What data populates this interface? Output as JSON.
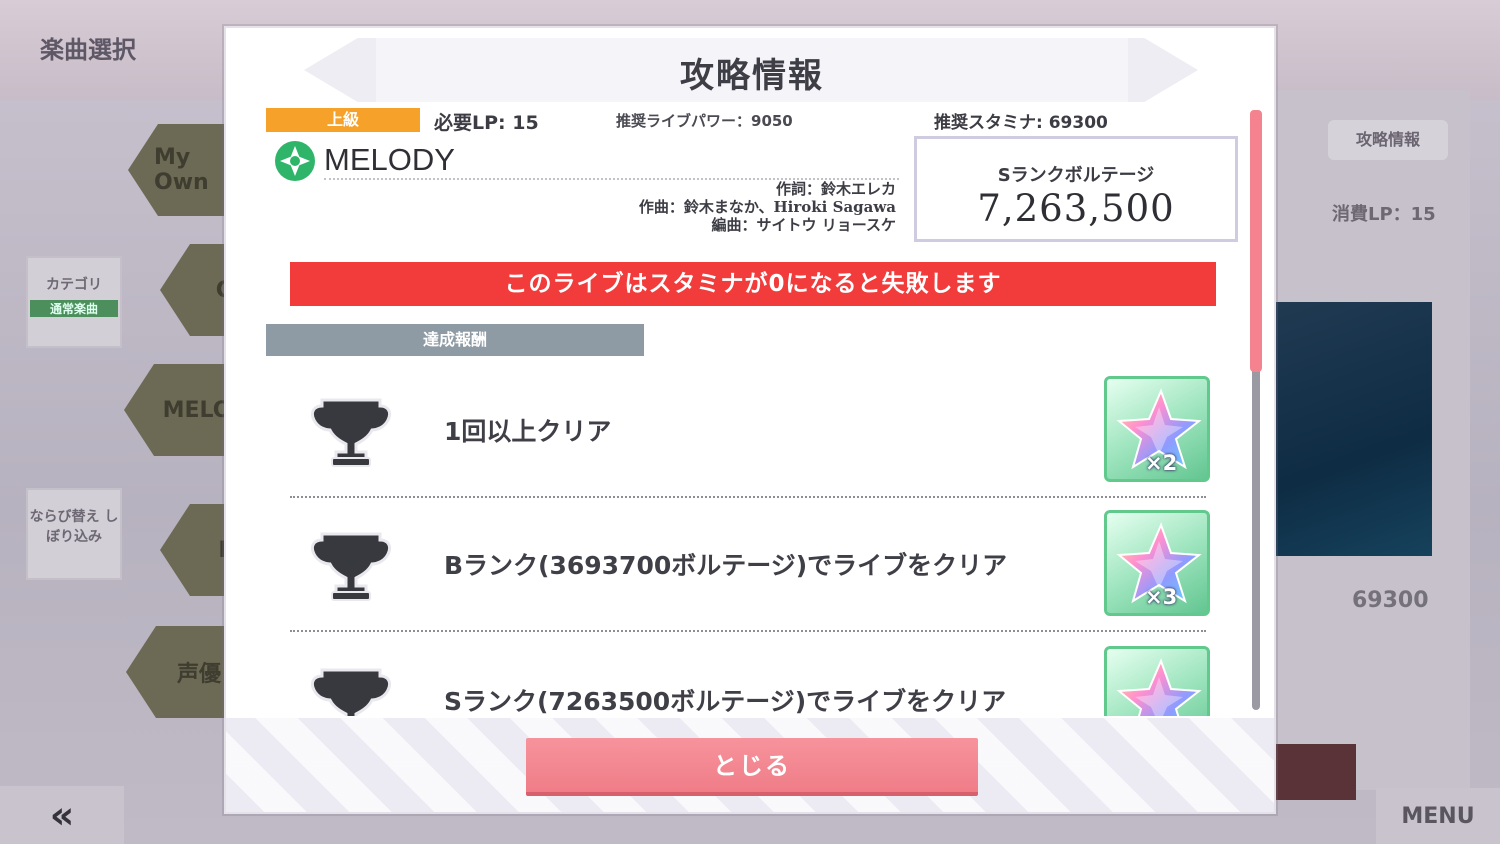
{
  "background": {
    "screen_title": "楽曲選択",
    "hex_labels": [
      "My Own",
      "CH",
      "MELO",
      "Ev",
      "声優"
    ],
    "category_label": "カテゴリ",
    "category_value": "通常楽曲",
    "sort_label": "ならび替え しぼり込み",
    "back_symbol": "«",
    "menu_label": "MENU",
    "side_info_button": "攻略情報",
    "side_lp": "消費LP：15",
    "side_stamina": "69300"
  },
  "dialog": {
    "title": "攻略情報",
    "difficulty": "上級",
    "required_lp": "必要LP: 15",
    "recommended_power": "推奨ライブパワー：9050",
    "recommended_stamina": "推奨スタミナ: 69300",
    "song_title": "MELODY",
    "credits": {
      "lyrics": "作詞：鈴木エレカ",
      "composer": "作曲：鈴木まなか、Hiroki Sagawa",
      "arranger": "編曲：サイトウ リョースケ"
    },
    "s_rank": {
      "label": "Sランクボルテージ",
      "value": "7,263,500"
    },
    "warning": "このライブはスタミナが0になると失敗します",
    "reward_header": "達成報酬",
    "missions": [
      {
        "label": "1回以上クリア",
        "reward_qty": "×2",
        "reward_icon": "star-gem-icon"
      },
      {
        "label": "Bランク(3693700ボルテージ)でライブをクリア",
        "reward_qty": "×3",
        "reward_icon": "star-gem-icon"
      },
      {
        "label": "Sランク(7263500ボルテージ)でライブをクリア",
        "reward_qty": "",
        "reward_icon": "star-gem-icon"
      }
    ],
    "close_label": "とじる"
  },
  "colors": {
    "difficulty": "#f5a12a",
    "warning": "#f23b3b",
    "close_button": "#f18590",
    "reward_frame": "#62c98d",
    "scroll_thumb": "#f4838f"
  }
}
